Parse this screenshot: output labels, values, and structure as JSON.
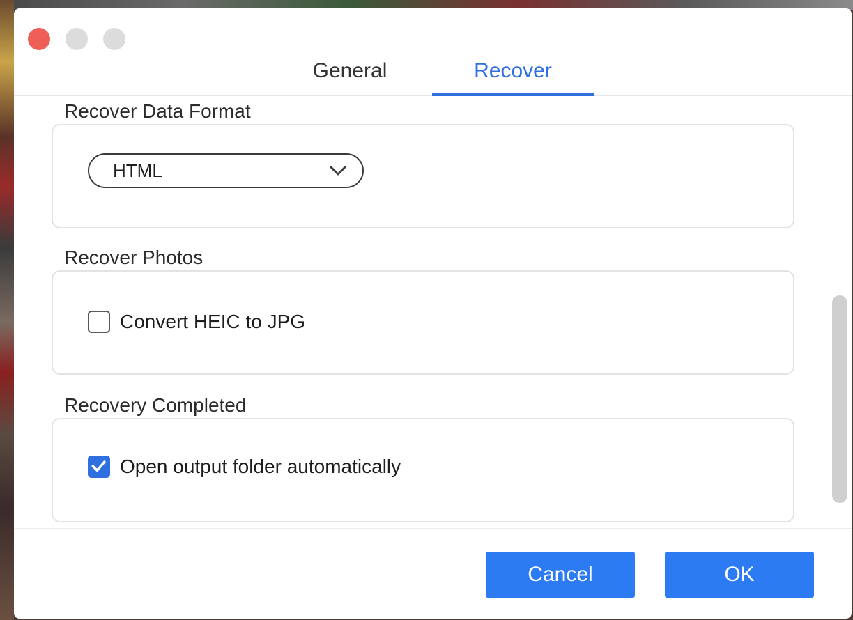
{
  "window": {
    "controls": {
      "close_color": "#ee5f57",
      "minimize_color": "#dcdcdc",
      "zoom_color": "#dcdcdc"
    }
  },
  "tabs": [
    {
      "label": "General",
      "active": false
    },
    {
      "label": "Recover",
      "active": true
    }
  ],
  "accent_color": "#2f6fe0",
  "sections": {
    "format": {
      "title": "Recover Data Format",
      "selected": "HTML",
      "icon": "chevron-down-icon"
    },
    "photos": {
      "title": "Recover Photos",
      "option_label": "Convert HEIC to JPG",
      "checked": false
    },
    "completed": {
      "title": "Recovery Completed",
      "option_label": "Open output folder automatically",
      "checked": true
    }
  },
  "footer": {
    "cancel_label": "Cancel",
    "ok_label": "OK",
    "button_color": "#2c7bf2"
  }
}
